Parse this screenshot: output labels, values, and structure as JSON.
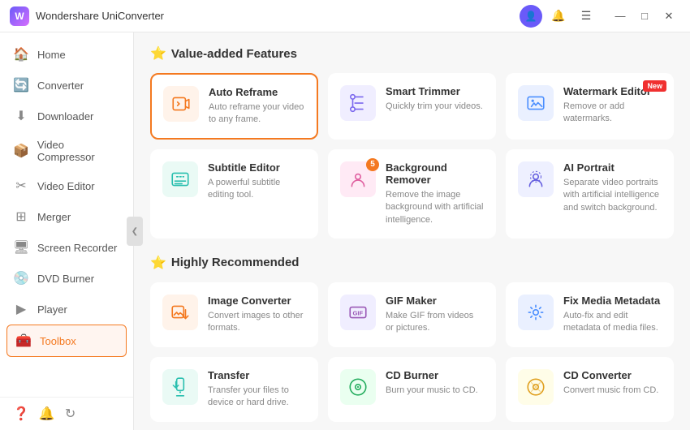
{
  "app": {
    "title": "Wondershare UniConverter",
    "logo_text": "W"
  },
  "titlebar": {
    "icons": [
      "user",
      "bell",
      "menu",
      "minimize",
      "maximize",
      "close"
    ],
    "minimize": "—",
    "maximize": "□",
    "close": "✕"
  },
  "sidebar": {
    "items": [
      {
        "id": "home",
        "label": "Home",
        "icon": "🏠",
        "active": false
      },
      {
        "id": "converter",
        "label": "Converter",
        "icon": "🔄",
        "active": false
      },
      {
        "id": "downloader",
        "label": "Downloader",
        "icon": "⬇️",
        "active": false
      },
      {
        "id": "video-compressor",
        "label": "Video Compressor",
        "icon": "📦",
        "active": false
      },
      {
        "id": "video-editor",
        "label": "Video Editor",
        "icon": "✂️",
        "active": false
      },
      {
        "id": "merger",
        "label": "Merger",
        "icon": "⊞",
        "active": false
      },
      {
        "id": "screen-recorder",
        "label": "Screen Recorder",
        "icon": "🖥",
        "active": false
      },
      {
        "id": "dvd-burner",
        "label": "DVD Burner",
        "icon": "💿",
        "active": false
      },
      {
        "id": "player",
        "label": "Player",
        "icon": "▶",
        "active": false
      },
      {
        "id": "toolbox",
        "label": "Toolbox",
        "icon": "🧰",
        "active": true
      }
    ],
    "bottom_icons": [
      "?",
      "🔔",
      "↻"
    ]
  },
  "content": {
    "section1": {
      "title": "Value-added Features",
      "icon": "⭐"
    },
    "section2": {
      "title": "Highly Recommended",
      "icon": "⭐"
    },
    "value_added": [
      {
        "id": "auto-reframe",
        "name": "Auto Reframe",
        "desc": "Auto reframe your video to any frame.",
        "icon": "🎬",
        "color": "orange",
        "selected": true,
        "new_badge": false
      },
      {
        "id": "smart-trimmer",
        "name": "Smart Trimmer",
        "desc": "Quickly trim your videos.",
        "icon": "✂",
        "color": "purple",
        "selected": false,
        "new_badge": false
      },
      {
        "id": "watermark-editor",
        "name": "Watermark Editor",
        "desc": "Remove or add watermarks.",
        "icon": "🖼",
        "color": "blue",
        "selected": false,
        "new_badge": true
      },
      {
        "id": "subtitle-editor",
        "name": "Subtitle Editor",
        "desc": "A powerful subtitle editing tool.",
        "icon": "📝",
        "color": "teal",
        "selected": false,
        "new_badge": false
      },
      {
        "id": "background-remover",
        "name": "Background Remover",
        "desc": "Remove the image background with artificial intelligence.",
        "icon": "🎭",
        "color": "pink",
        "selected": false,
        "new_badge": false,
        "notification": true
      },
      {
        "id": "ai-portrait",
        "name": "AI Portrait",
        "desc": "Separate video portraits with artificial intelligence and switch background.",
        "icon": "👤",
        "color": "indigo",
        "selected": false,
        "new_badge": false
      }
    ],
    "recommended": [
      {
        "id": "image-converter",
        "name": "Image Converter",
        "desc": "Convert images to other formats.",
        "icon": "🖼",
        "color": "orange",
        "selected": false,
        "new_badge": false
      },
      {
        "id": "gif-maker",
        "name": "GIF Maker",
        "desc": "Make GIF from videos or pictures.",
        "icon": "🎞",
        "color": "purple",
        "selected": false,
        "new_badge": false
      },
      {
        "id": "fix-media-metadata",
        "name": "Fix Media Metadata",
        "desc": "Auto-fix and edit metadata of media files.",
        "icon": "🔧",
        "color": "blue",
        "selected": false,
        "new_badge": false
      },
      {
        "id": "transfer",
        "name": "Transfer",
        "desc": "Transfer your files to device or hard drive.",
        "icon": "📱",
        "color": "teal",
        "selected": false,
        "new_badge": false
      },
      {
        "id": "cd-burner",
        "name": "CD Burner",
        "desc": "Burn your music to CD.",
        "icon": "💿",
        "color": "green",
        "selected": false,
        "new_badge": false
      },
      {
        "id": "cd-converter",
        "name": "CD Converter",
        "desc": "Convert music from CD.",
        "icon": "🔀",
        "color": "yellow",
        "selected": false,
        "new_badge": false
      }
    ]
  }
}
